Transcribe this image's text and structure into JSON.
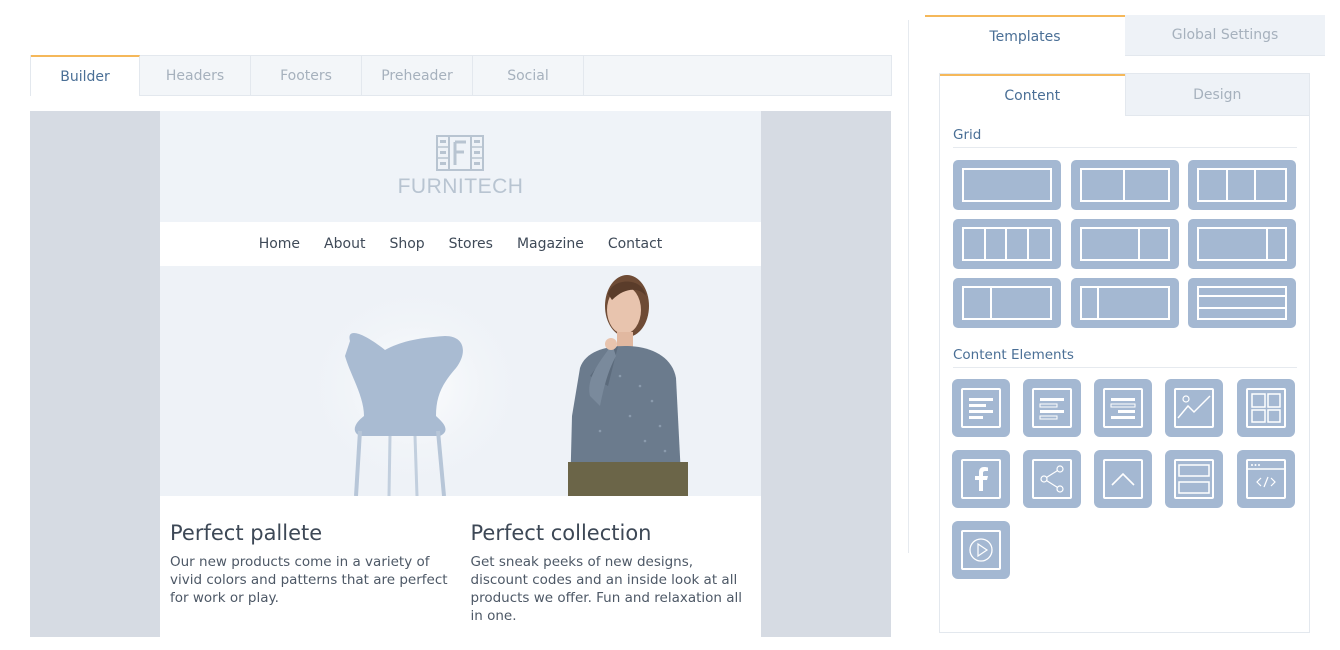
{
  "builder_tabs": [
    {
      "label": "Builder",
      "active": true
    },
    {
      "label": "Headers",
      "active": false
    },
    {
      "label": "Footers",
      "active": false
    },
    {
      "label": "Preheader",
      "active": false
    },
    {
      "label": "Social",
      "active": false
    }
  ],
  "email": {
    "logo_text": "FURNITECH",
    "nav": [
      "Home",
      "About",
      "Shop",
      "Stores",
      "Magazine",
      "Contact"
    ],
    "columns": [
      {
        "title": "Perfect pallete",
        "body": "Our new products come in a variety of vivid colors  and patterns that are perfect for work or play."
      },
      {
        "title": "Perfect collection",
        "body": "Get sneak peeks of new designs, discount codes and an inside look at all products we offer. Fun and relaxation all in one."
      }
    ]
  },
  "sidebar": {
    "tabs": [
      {
        "label": "Templates",
        "active": true
      },
      {
        "label": "Global Settings",
        "active": false
      }
    ],
    "panel_tabs": [
      {
        "label": "Content",
        "active": true
      },
      {
        "label": "Design",
        "active": false
      }
    ],
    "grid_title": "Grid",
    "grid_layouts": [
      "1 column",
      "2 columns",
      "3 columns",
      "4 columns",
      "2 columns (wide left)",
      "2 columns (wide left, narrow right)",
      "2 columns (narrow left)",
      "2 columns (narrow left, wide right)",
      "3 rows"
    ],
    "content_elements_title": "Content Elements",
    "content_elements": [
      "text-left-icon",
      "text-mixed-icon",
      "text-right-icon",
      "image-icon",
      "gallery-icon",
      "facebook-icon",
      "share-icon",
      "back-to-top-icon",
      "divider-icon",
      "html-code-icon",
      "video-icon"
    ]
  },
  "colors": {
    "accent": "#f5b85a",
    "tile": "#a4b8d2",
    "link": "#4a6f96",
    "canvas": "#d6dbe3"
  }
}
